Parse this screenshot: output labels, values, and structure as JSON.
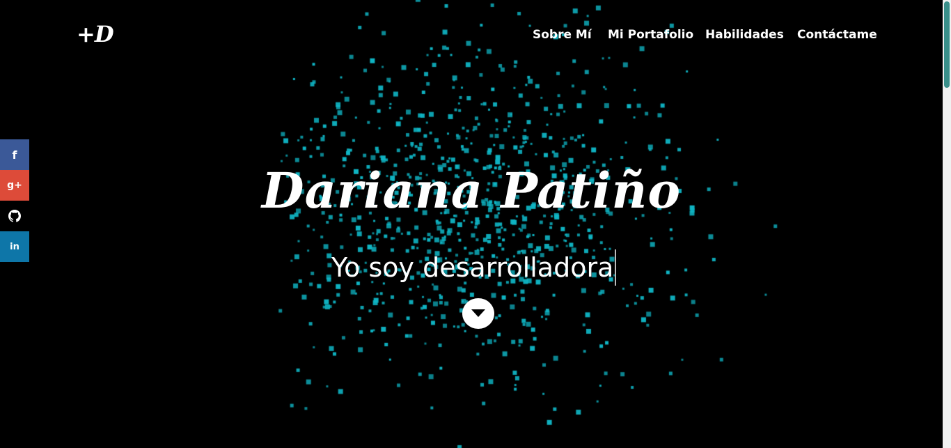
{
  "logo": "+D",
  "nav": {
    "items": [
      "Sobre Mí",
      "Mi Portafolio",
      "Habilidades",
      "Contáctame"
    ]
  },
  "social": [
    {
      "icon": "facebook-icon",
      "glyph": "f",
      "color": "#3b5998"
    },
    {
      "icon": "google-plus-icon",
      "glyph": "g+",
      "color": "#dd4b39"
    },
    {
      "icon": "github-icon",
      "glyph": "",
      "color": "#000000"
    },
    {
      "icon": "linkedin-icon",
      "glyph": "in",
      "color": "#0e76a8"
    }
  ],
  "hero": {
    "name": "Dariana Patiño",
    "subtitle": "Yo soy desarrolladora"
  },
  "colors": {
    "background": "#000000",
    "particle": "#0fb5c4",
    "text": "#ffffff"
  }
}
